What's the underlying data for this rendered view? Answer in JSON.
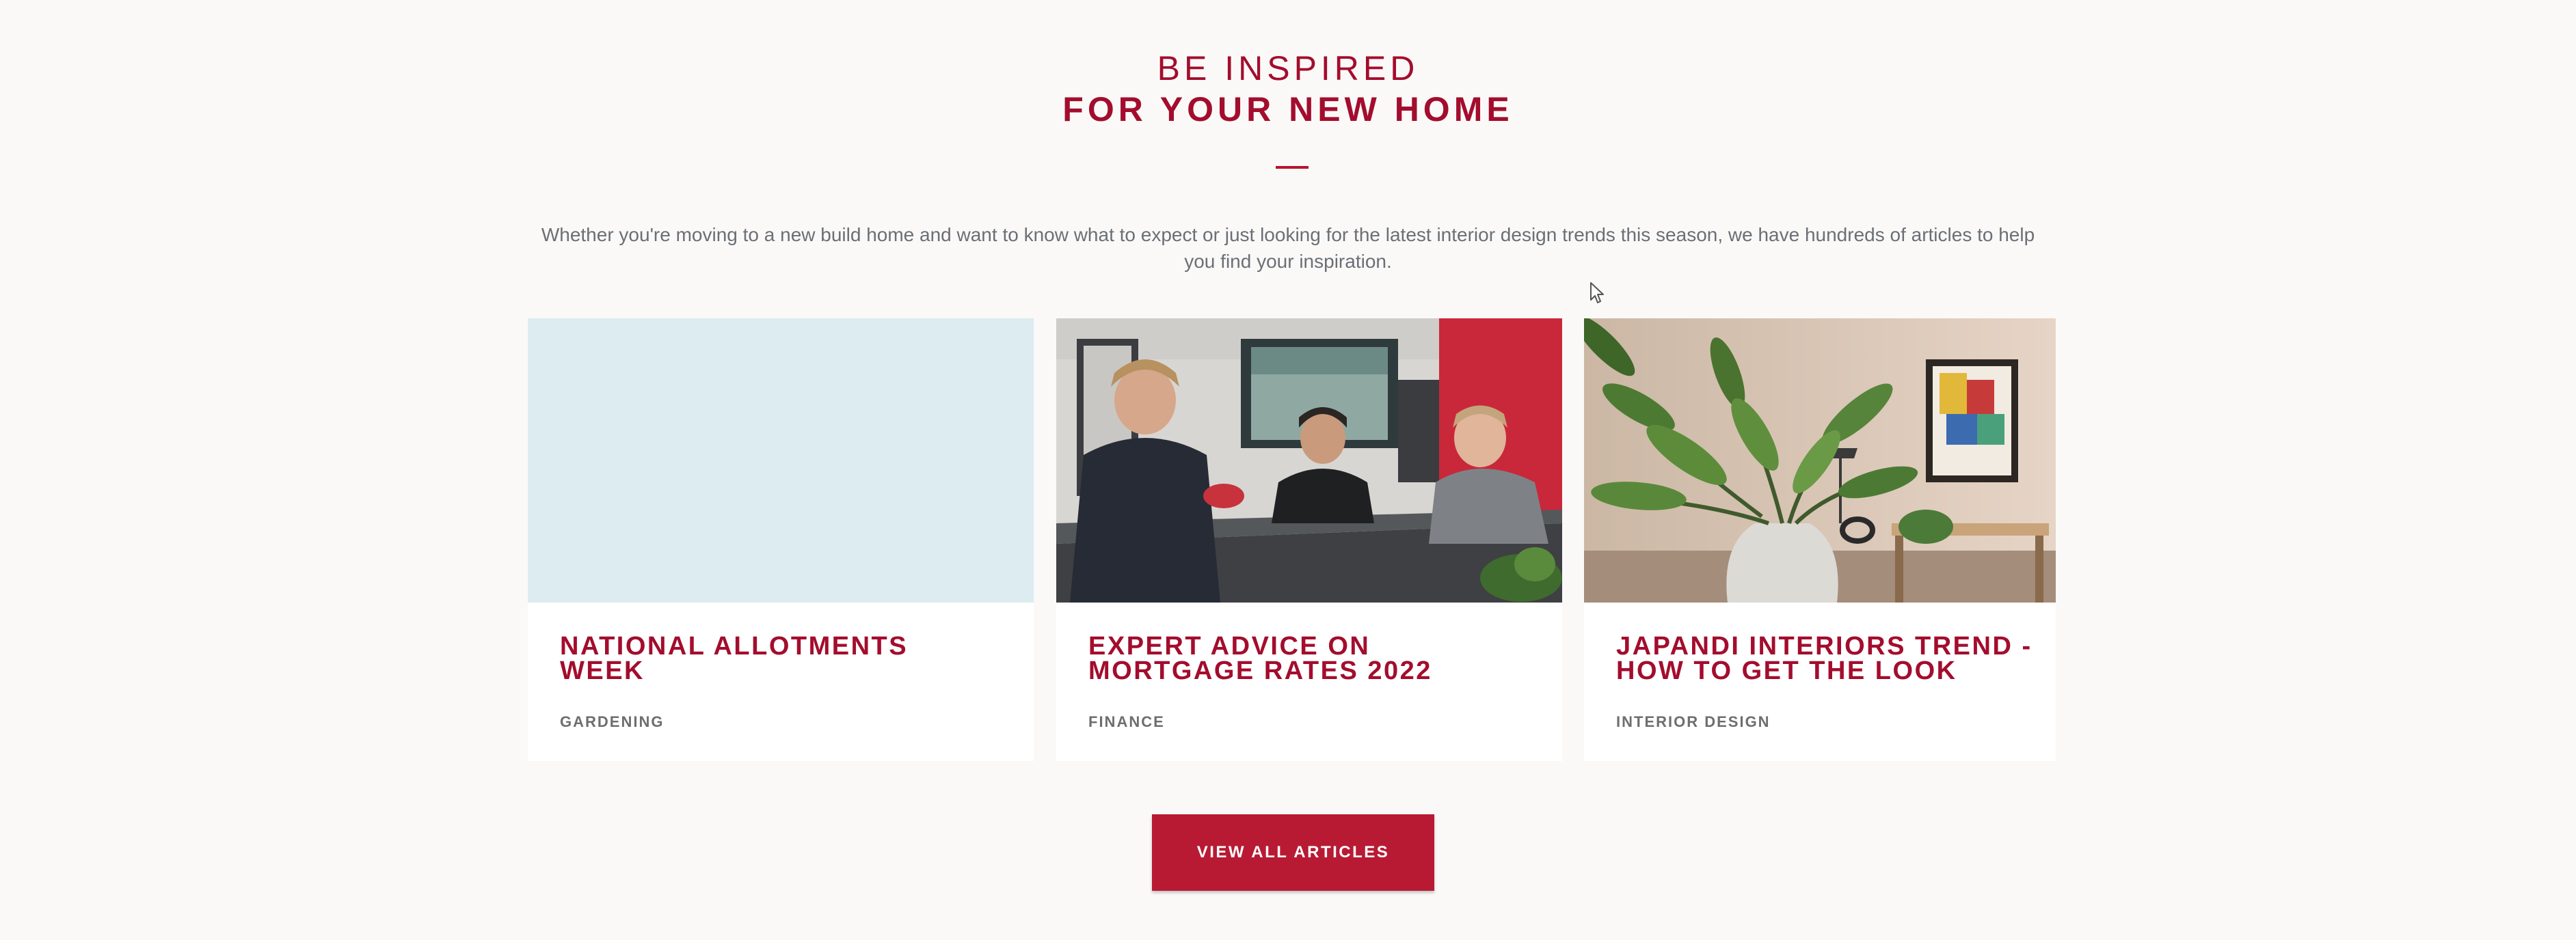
{
  "section": {
    "heading_pre": "BE INSPIRED",
    "heading_main": "FOR YOUR NEW HOME",
    "intro": "Whether you're moving to a new build home and want to know what to expect or just looking for the latest interior design trends this season, we have hundreds of articles to help you find your inspiration."
  },
  "articles": [
    {
      "title": "NATIONAL ALLOTMENTS WEEK",
      "category": "GARDENING",
      "image": "blank-placeholder"
    },
    {
      "title": "EXPERT ADVICE ON MORTGAGE RATES 2022",
      "category": "FINANCE",
      "image": "meeting-room-photo"
    },
    {
      "title": "JAPANDI INTERIORS TREND - HOW TO GET THE LOOK",
      "category": "INTERIOR DESIGN",
      "image": "interior-plant-photo"
    }
  ],
  "cta": {
    "label": "VIEW ALL ARTICLES"
  },
  "colors": {
    "brand": "#a30d2d",
    "button": "#b81a34",
    "background": "#faf9f8",
    "placeholder": "#dcecf0"
  }
}
